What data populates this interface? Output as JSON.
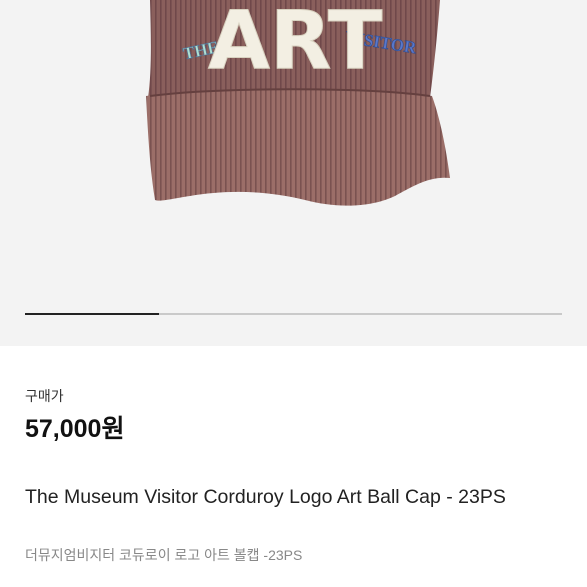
{
  "product": {
    "image": {
      "alt": "brown corduroy ball cap with ART logo",
      "cap_color": "#8a5f5c",
      "logo_text": "ART",
      "embroidery_text": "THE MUSEUM VISITOR",
      "progress": 0.25
    },
    "price_label": "구매가",
    "price": "57,000원",
    "title": "The Museum Visitor Corduroy Logo Art Ball Cap - 23PS",
    "subtitle": "더뮤지엄비지터 코듀로이 로고 아트 볼캡 -23PS"
  }
}
